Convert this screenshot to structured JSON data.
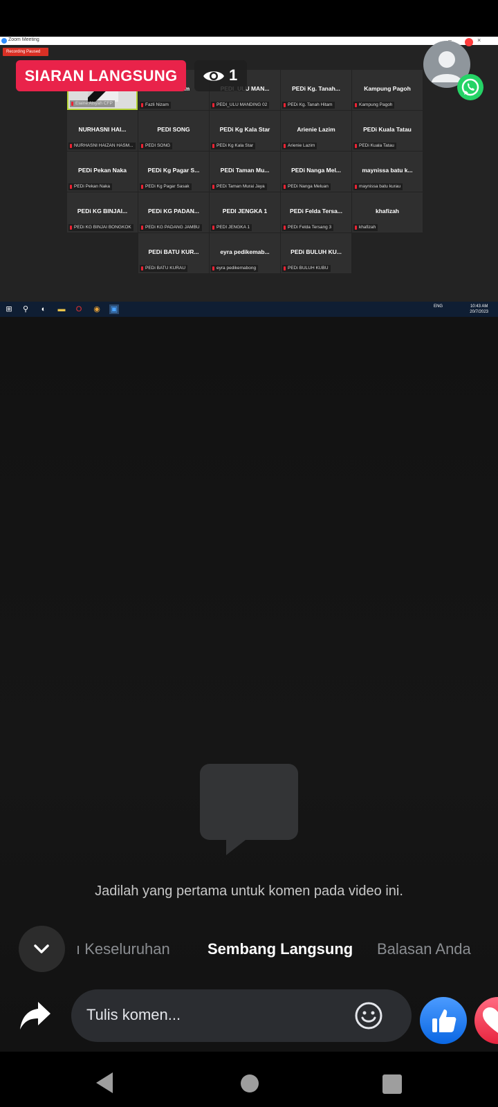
{
  "zoom": {
    "window_title": "Zoom Meeting",
    "recording_status": "Recording Paused",
    "participants": [
      {
        "name": "",
        "label": "Elaine Aisyah CFP",
        "active": true
      },
      {
        "name": "Fazli Nizam",
        "label": "Fazli Nizam"
      },
      {
        "name": "PEDI_ULU MAN...",
        "label": "PEDI_ULU MANDING 02"
      },
      {
        "name": "PEDi Kg. Tanah...",
        "label": "PEDi Kg. Tanah Hitam"
      },
      {
        "name": "Kampung Pagoh",
        "label": "Kampung Pagoh"
      },
      {
        "name": "NURHASNI HAI...",
        "label": "NURHASNI HAIZAN HASM..."
      },
      {
        "name": "PEDI SONG",
        "label": "PEDI SONG"
      },
      {
        "name": "PEDi Kg Kala Star",
        "label": "PEDi Kg Kala Star"
      },
      {
        "name": "Arienie Lazim",
        "label": "Arienie Lazim"
      },
      {
        "name": "PEDi Kuala Tatau",
        "label": "PEDi Kuala Tatau"
      },
      {
        "name": "PEDi Pekan Naka",
        "label": "PEDi Pekan Naka"
      },
      {
        "name": "PEDi Kg Pagar S...",
        "label": "PEDi Kg Pagar Sasak"
      },
      {
        "name": "PEDi Taman Mu...",
        "label": "PEDi Taman Murai Jaya"
      },
      {
        "name": "PEDi Nanga Mel...",
        "label": "PEDi Nanga Meluan"
      },
      {
        "name": "maynissa batu k...",
        "label": "maynissa batu kurau"
      },
      {
        "name": "PEDi KG BINJAI...",
        "label": "PEDi KG BINJAI BONGKOK"
      },
      {
        "name": "PEDi KG PADAN...",
        "label": "PEDi KG PADANG JAMBU"
      },
      {
        "name": "PEDI JENGKA 1",
        "label": "PEDI JENGKA 1"
      },
      {
        "name": "PEDi Felda Tersa...",
        "label": "PEDi Felda Tersang 3"
      },
      {
        "name": "khafizah",
        "label": "khafizah"
      },
      {
        "name": "PEDi BATU KUR...",
        "label": "PEDi BATU KURAU"
      },
      {
        "name": "eyra pedikemab...",
        "label": "eyra pedikemabong"
      },
      {
        "name": "PEDi BULUH KU...",
        "label": "PEDi BULUH KUBU"
      }
    ],
    "taskbar": {
      "language": "ENG",
      "time": "10:43 AM",
      "date": "20/7/2023"
    }
  },
  "live": {
    "badge": "SIARAN LANGSUNG",
    "viewer_count": "1"
  },
  "comments": {
    "empty_message": "Jadilah yang pertama untuk komen pada video ini.",
    "tabs": [
      {
        "label": "ı Keseluruhan",
        "active": false
      },
      {
        "label": "Sembang Langsung",
        "active": true
      },
      {
        "label": "Balasan Anda",
        "active": false
      }
    ],
    "input_placeholder": "Tulis komen..."
  },
  "colors": {
    "live_red": "#e9234a",
    "like_blue": "#1877f2",
    "whatsapp_green": "#25d366"
  }
}
